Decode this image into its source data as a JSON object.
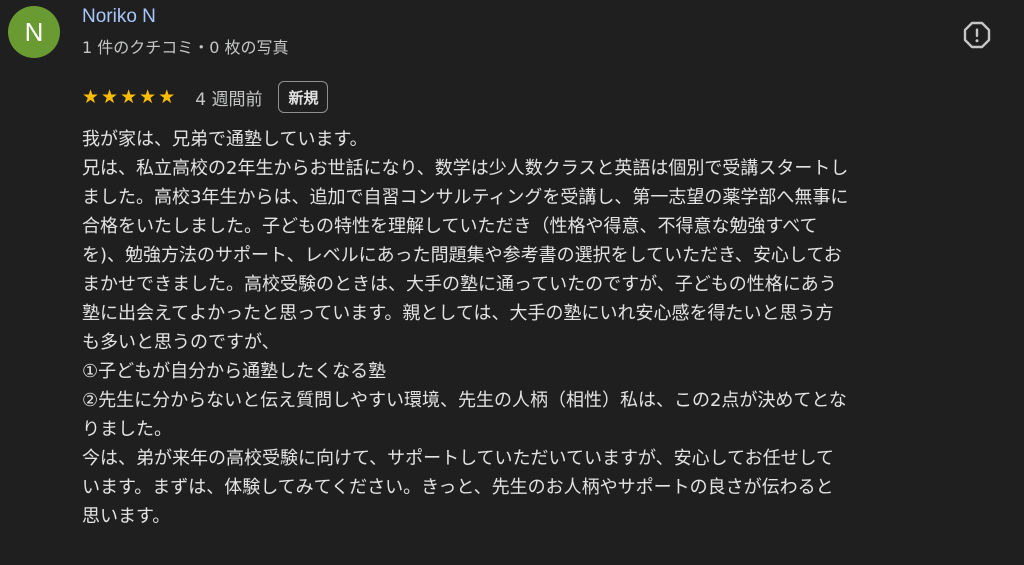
{
  "reviewer": {
    "initial": "N",
    "name": "Noriko N",
    "meta": "1 件のクチコミ・0 枚の写真",
    "avatar_color": "#6a9b32"
  },
  "icons": {
    "flag": "report-flag-icon",
    "star": "star-icon"
  },
  "review": {
    "rating": 5,
    "date": "4 週間前",
    "badge": "新規",
    "lines": [
      "我が家は、兄弟で通塾しています。",
      "兄は、私立高校の2年生からお世話になり、数学は少人数クラスと英語は個別で受講スタートし",
      "ました。高校3年生からは、追加で自習コンサルティングを受講し、第一志望の薬学部へ無事に",
      "合格をいたしました。子どもの特性を理解していただき（性格や得意、不得意な勉強すべて",
      "を)、勉強方法のサポート、レベルにあった問題集や参考書の選択をしていただき、安心してお",
      "まかせできました。高校受験のときは、大手の塾に通っていたのですが、子どもの性格にあう",
      "塾に出会えてよかったと思っています。親としては、大手の塾にいれ安心感を得たいと思う方",
      "も多いと思うのですが、",
      "①子どもが自分から通塾したくなる塾",
      "②先生に分からないと伝え質問しやすい環境、先生の人柄（相性）私は、この2点が決めてとな",
      "りました。",
      "今は、弟が来年の高校受験に向けて、サポートしていただいていますが、安心してお任せして",
      "います。まずは、体験してみてください。きっと、先生のお人柄やサポートの良さが伝わると",
      "思います。"
    ]
  },
  "colors": {
    "background": "#1f1f1f",
    "name": "#a8c7fa",
    "star": "#fbbc04"
  }
}
